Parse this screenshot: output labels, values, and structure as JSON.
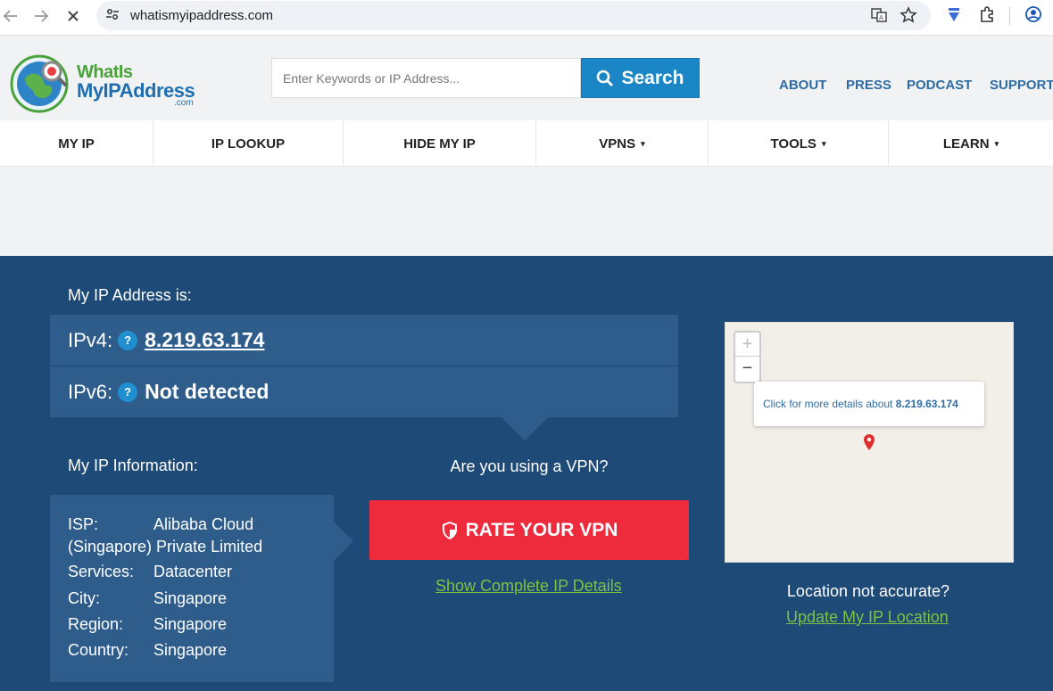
{
  "browser": {
    "url": "whatismyipaddress.com",
    "back_icon": "arrow-left",
    "forward_icon": "arrow-right",
    "stop_icon": "close",
    "icons": [
      "site-settings-tune",
      "translate",
      "star-bookmark",
      "extension-shield",
      "puzzle-extensions",
      "profile"
    ]
  },
  "header": {
    "logo": {
      "line1": "WhatIs",
      "line2": "MyIPAddress",
      "line3": ".com"
    },
    "search": {
      "placeholder": "Enter Keywords or IP Address...",
      "button_label": "Search"
    },
    "links": [
      "ABOUT",
      "PRESS",
      "PODCAST",
      "SUPPORT"
    ]
  },
  "nav": {
    "items": [
      {
        "label": "MY IP"
      },
      {
        "label": "IP LOOKUP"
      },
      {
        "label": "HIDE MY IP"
      },
      {
        "label": "VPNS",
        "caret": "▾"
      },
      {
        "label": "TOOLS",
        "caret": "▾"
      },
      {
        "label": "LEARN",
        "caret": "▾"
      }
    ]
  },
  "hero": {
    "my_ip_title": "My IP Address is:",
    "ipv4_label": "IPv4:",
    "ipv4_value": "8.219.63.174",
    "ipv6_label": "IPv6:",
    "ipv6_value": "Not detected",
    "help_glyph": "?",
    "info_title": "My IP Information:",
    "info": {
      "isp_label": "ISP:",
      "isp_line1": "Alibaba Cloud",
      "isp_line2": "(Singapore) Private Limited",
      "services_label": "Services:",
      "services_value": "Datacenter",
      "city_label": "City:",
      "city_value": "Singapore",
      "region_label": "Region:",
      "region_value": "Singapore",
      "country_label": "Country:",
      "country_value": "Singapore"
    },
    "vpn_question": "Are you using a VPN?",
    "rate_button": "RATE YOUR VPN",
    "details_link": "Show Complete IP Details",
    "map": {
      "zoom_in": "+",
      "zoom_out": "−",
      "popup_text": "Click for more details about ",
      "popup_ip": "8.219.63.174"
    },
    "location_question": "Location not accurate?",
    "update_link": "Update My IP Location"
  },
  "colors": {
    "hero_bg": "#1e4a78",
    "panel_bg": "#2e5d8c",
    "search_btn": "#1a86c5",
    "rate_btn": "#ee2a3d",
    "link_green": "#7dc242",
    "top_link": "#2d6ca2"
  }
}
